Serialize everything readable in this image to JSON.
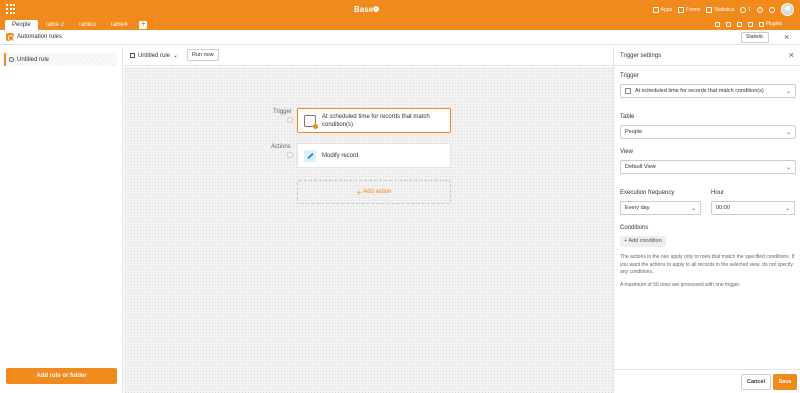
{
  "app": {
    "base_title": "Base",
    "tabs": [
      "People",
      "Table 2",
      "Table3",
      "Table4"
    ],
    "top_right": {
      "apps": "Apps",
      "forms": "Forms",
      "statistics": "Statistics",
      "collaborators": "1",
      "plugins": "Plugins"
    }
  },
  "dialog": {
    "title": "Automation rules",
    "statistic": "Statistic"
  },
  "left": {
    "rule": "Untitled rule",
    "add_rule": "Add rule or folder"
  },
  "middle": {
    "rule_name": "Untitled rule",
    "run_now": "Run now",
    "trigger_label": "Trigger",
    "actions_label": "Actions",
    "trigger_node_line1": "At scheduled time for records that match",
    "trigger_node_line2": "condition(s)",
    "action_node": "Modify record",
    "add_action": "Add action"
  },
  "settings": {
    "title": "Trigger settings",
    "trigger_label": "Trigger",
    "trigger_value": "At scheduled time for records that match condition(s)",
    "table_label": "Table",
    "table_value": "People",
    "view_label": "View",
    "view_value": "Default View",
    "frequency_label": "Execution frequency",
    "frequency_value": "Every day",
    "hour_label": "Hour",
    "hour_value": "00:00",
    "conditions_label": "Conditions",
    "add_condition": "Add condition",
    "help_1": "The actions in the rule apply only to rows that match the specified conditions. If you want the actions to apply to all records in the selected view, do not specify any conditions.",
    "help_2": "A maximum of 50 rows are processed with one trigger.",
    "cancel": "Cancel",
    "save": "Save"
  },
  "colors": {
    "accent": "#f08a1d"
  }
}
